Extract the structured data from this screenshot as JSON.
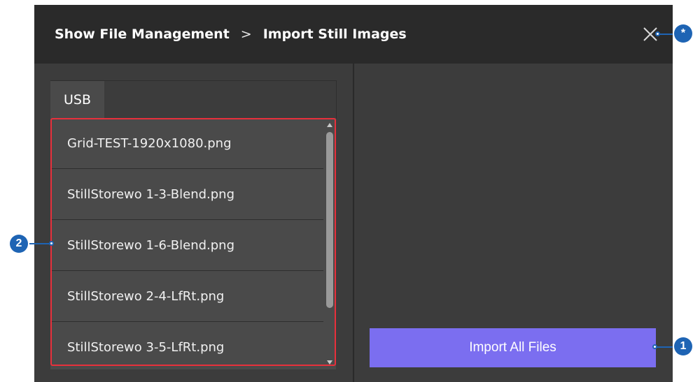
{
  "header": {
    "breadcrumb_parent": "Show File Management",
    "breadcrumb_separator": ">",
    "breadcrumb_current": "Import Still Images",
    "close_icon": "close-icon"
  },
  "source_tabs": [
    {
      "label": "USB",
      "selected": true
    }
  ],
  "files": [
    "Grid-TEST-1920x1080.png",
    "StillStorewo 1-3-Blend.png",
    "StillStorewo 1-6-Blend.png",
    "StillStorewo 2-4-LfRt.png",
    "StillStorewo 3-5-LfRt.png"
  ],
  "import_button_label": "Import All Files",
  "callouts": {
    "close": "*",
    "import_button": "1",
    "file_list": "2"
  },
  "colors": {
    "accent_button": "#7b6ef0",
    "callout": "#1e64b4",
    "highlight_outline": "#e8303c"
  }
}
